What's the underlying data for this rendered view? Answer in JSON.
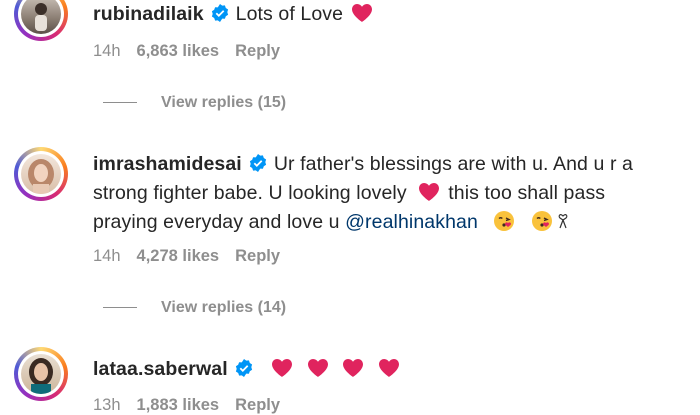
{
  "comments": [
    {
      "username": "rubinadilaik",
      "text": "Lots of Love",
      "time": "14h",
      "likes": "6,863 likes",
      "reply": "Reply",
      "view_replies": "View replies (15)"
    },
    {
      "username": "imrashamidesai",
      "text_line1": "Ur father's blessings are with u. And u r a",
      "text_line2a": "strong fighter babe. U looking lovely",
      "text_line2b": "this too shall pass",
      "text_line3a": "praying everyday and love u",
      "mention": "@realhinakhan",
      "time": "14h",
      "likes": "4,278 likes",
      "reply": "Reply",
      "view_replies": "View replies (14)"
    },
    {
      "username": "lataa.saberwal",
      "time": "13h",
      "likes": "1,883 likes",
      "reply": "Reply"
    }
  ],
  "icons": {
    "verified": "verified-badge-icon",
    "heart": "red-heart-icon",
    "kiss": "face-blowing-kiss-icon"
  },
  "colors": {
    "verified_blue": "#0095f6",
    "heart_red": "#e0245e",
    "meta_gray": "#8e8e8e",
    "mention_blue": "#00376b"
  }
}
